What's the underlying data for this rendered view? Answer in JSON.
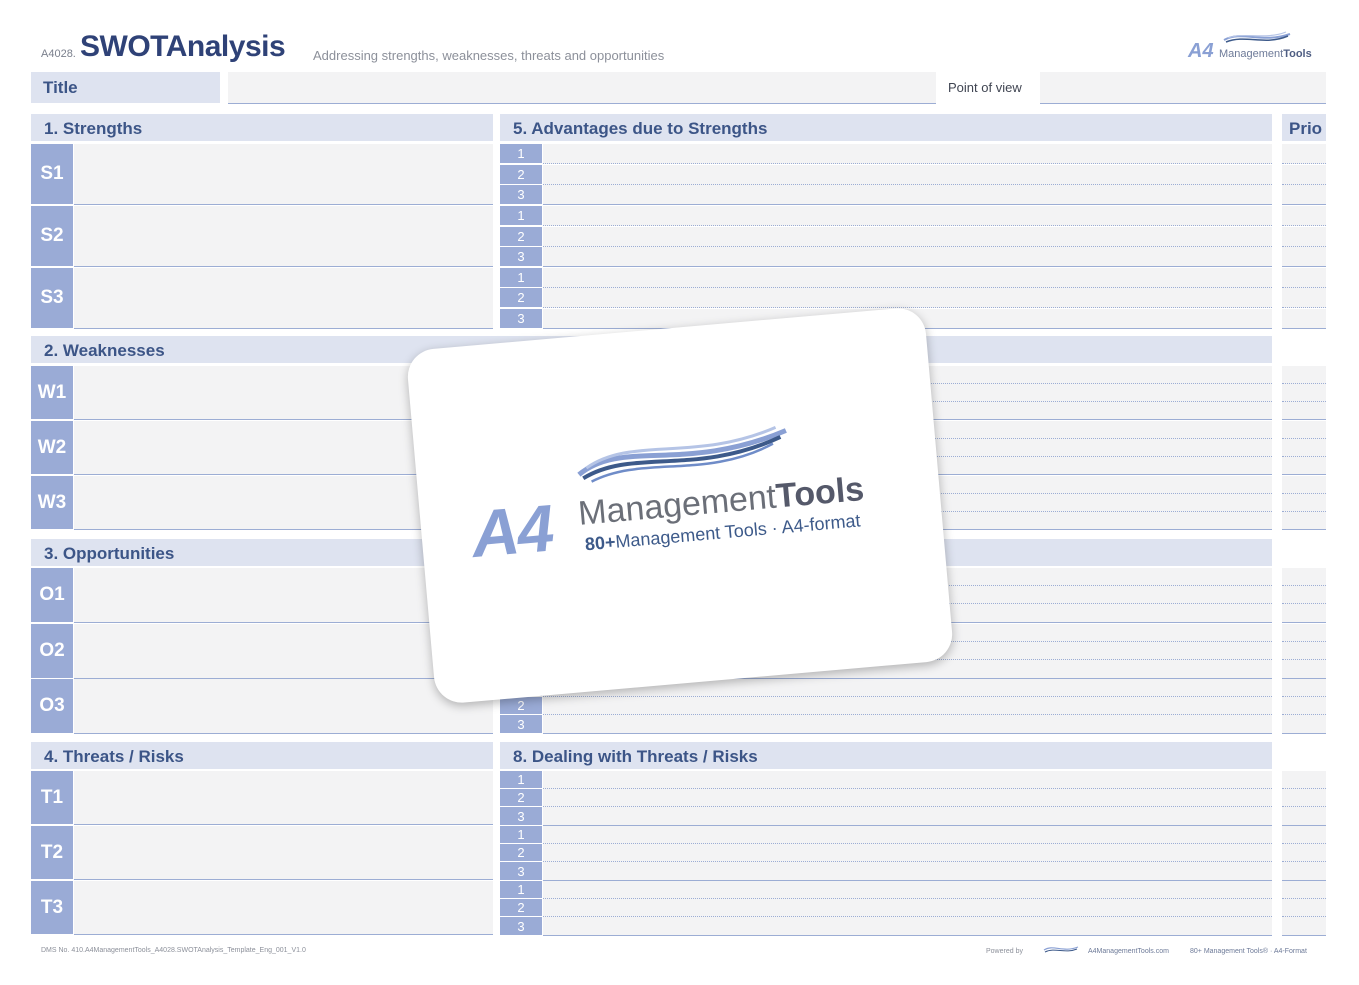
{
  "header": {
    "code": "A4028.",
    "title": "SWOTAnalysis",
    "subtitle": "Addressing strengths, weaknesses, threats and opportunities",
    "brand_a4": "A4",
    "brand_management": "Management",
    "brand_tools": "Tools"
  },
  "title_row": {
    "title_label": "Title",
    "point_of_view_label": "Point of view"
  },
  "sections": {
    "strengths": "1. Strengths",
    "weaknesses": "2. Weaknesses",
    "opportunities": "3. Opportunities",
    "threats": "4. Threats / Risks",
    "advantages": "5. Advantages due to Strengths",
    "dealing_threats": "8. Dealing with Threats / Risks",
    "prio": "Prio"
  },
  "left_blocks": {
    "strengths": [
      "S1",
      "S2",
      "S3"
    ],
    "weaknesses": [
      "W1",
      "W2",
      "W3"
    ],
    "opportunities": [
      "O1",
      "O2",
      "O3"
    ],
    "threats": [
      "T1",
      "T2",
      "T3"
    ]
  },
  "row_numbers": [
    "1",
    "2",
    "3"
  ],
  "overlay_card": {
    "a4": "A4",
    "management": "Management",
    "tools": "Tools",
    "tagline_bold": "80+",
    "tagline_rest": "Management Tools · A4-format"
  },
  "footer": {
    "dms": "DMS No. 410.A4ManagementTools_A4028.SWOTAnalysis_Template_Eng_001_V1.0",
    "powered_by": "Powered by",
    "site": "A4ManagementTools.com",
    "tagline": "80+ Management Tools® · A4-Format"
  },
  "colors": {
    "accent": "#9aabd6",
    "header_fill": "#dee3f0",
    "title_text": "#2f4277",
    "field_fill": "#f3f3f4"
  }
}
